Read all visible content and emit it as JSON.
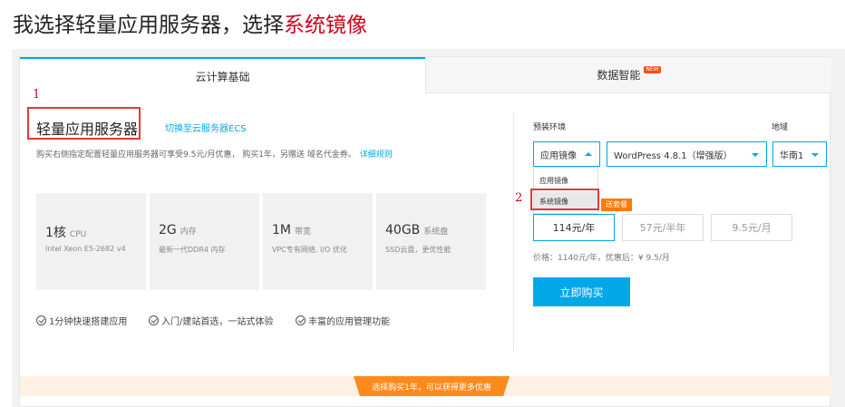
{
  "heading": {
    "prefix": "我选择轻量应用服务器，选择",
    "highlight": "系统镜像"
  },
  "tabs": [
    {
      "label": "云计算基础"
    },
    {
      "label": "数据智能",
      "badge": "NEW"
    }
  ],
  "annotations": {
    "one": "1",
    "two": "2"
  },
  "product": {
    "title": "轻量应用服务器",
    "switch_link": "切换至云服务器ECS",
    "description": "购买右侧指定配置轻量应用服务器可享受9.5元/月优惠， 购买1年，另赠送 域名代金券。",
    "detail_link": "详细规则"
  },
  "specs": [
    {
      "value": "1核",
      "unit": "CPU",
      "sub": "Intel Xeon E5-2682 v4"
    },
    {
      "value": "2G",
      "unit": "内存",
      "sub": "最新一代DDR4 内存"
    },
    {
      "value": "1M",
      "unit": "带宽",
      "sub": "VPC专有网络, I/O 优化"
    },
    {
      "value": "40GB",
      "unit": "系统盘",
      "sub": "SSD云盘，更优性能"
    }
  ],
  "features": [
    "1分钟快速搭建应用",
    "入门/建站首选，一站式体验",
    "丰富的应用管理功能"
  ],
  "config": {
    "env_label": "预装环境",
    "region_label": "地域",
    "env_selected": "应用镜像",
    "env_options": [
      "应用镜像",
      "系统镜像"
    ],
    "wordpress": "WordPress 4.8.1（增强版）",
    "region": "华南1",
    "promo_tag": "送套餐",
    "prices": [
      "114元/年",
      "57元/半年",
      "9.5元/月"
    ],
    "price_info": "价格：1140元/年，优惠后：¥ 9.5/月",
    "buy": "立即购买"
  },
  "bottom_banner": "选择购买1年，可以获得更多优惠",
  "colors": {
    "accent": "#00a8e8",
    "annotation": "#d0021b",
    "orange": "#ff8a1c"
  }
}
